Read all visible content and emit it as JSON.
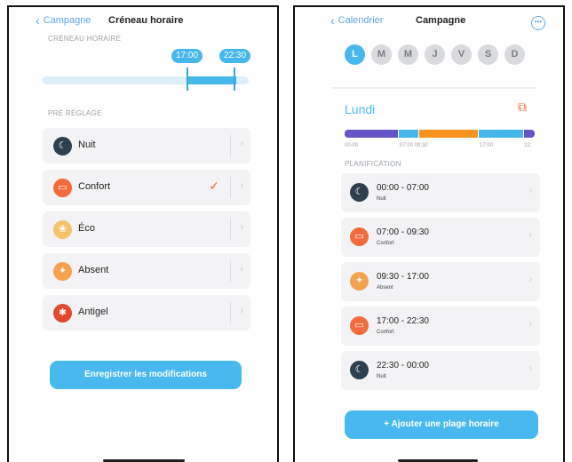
{
  "left": {
    "back_label": "Campagne",
    "title": "Créneau horaire",
    "section_slot": "CRÉNEAU HORAIRE",
    "range": {
      "start": "17:00",
      "end": "22:30"
    },
    "section_preset": "PRÉ RÉGLAGE",
    "presets": [
      {
        "label": "Nuit",
        "icon": "moon-icon",
        "color": "#2e3f4f"
      },
      {
        "label": "Confort",
        "icon": "sofa-icon",
        "color": "#f26b3a",
        "selected": true
      },
      {
        "label": "Éco",
        "icon": "eco-icon",
        "color": "#f4c26b"
      },
      {
        "label": "Absent",
        "icon": "walking-icon",
        "color": "#f5a150"
      },
      {
        "label": "Antigel",
        "icon": "snowflake-icon",
        "color": "#e0482f"
      }
    ],
    "save_button": "Enregistrer les modifications"
  },
  "right": {
    "back_label": "Calendrier",
    "title": "Campagne",
    "days": [
      "L",
      "M",
      "M",
      "J",
      "V",
      "S",
      "D"
    ],
    "active_day_index": 0,
    "day_title": "Lundi",
    "timeline_ticks": [
      "00:00",
      "07:00 09:30",
      "17:00",
      "22:"
    ],
    "section_plan": "PLANIFICATION",
    "slots": [
      {
        "time": "00:00 - 07:00",
        "mode": "Nuit",
        "icon": "moon-icon",
        "color": "#2e3f4f"
      },
      {
        "time": "07:00 - 09:30",
        "mode": "Confort",
        "icon": "sofa-icon",
        "color": "#f26b3a"
      },
      {
        "time": "09:30 - 17:00",
        "mode": "Absent",
        "icon": "walking-icon",
        "color": "#f5a150"
      },
      {
        "time": "17:00 - 22:30",
        "mode": "Confort",
        "icon": "sofa-icon",
        "color": "#f26b3a"
      },
      {
        "time": "22:30 - 00:00",
        "mode": "Nuit",
        "icon": "moon-icon",
        "color": "#2e3f4f"
      }
    ],
    "add_button": "+ Ajouter une plage horaire",
    "timeline_colors": {
      "night": "#6355c7",
      "comfort": "#f7931e",
      "absent": "#45b7ea"
    }
  }
}
